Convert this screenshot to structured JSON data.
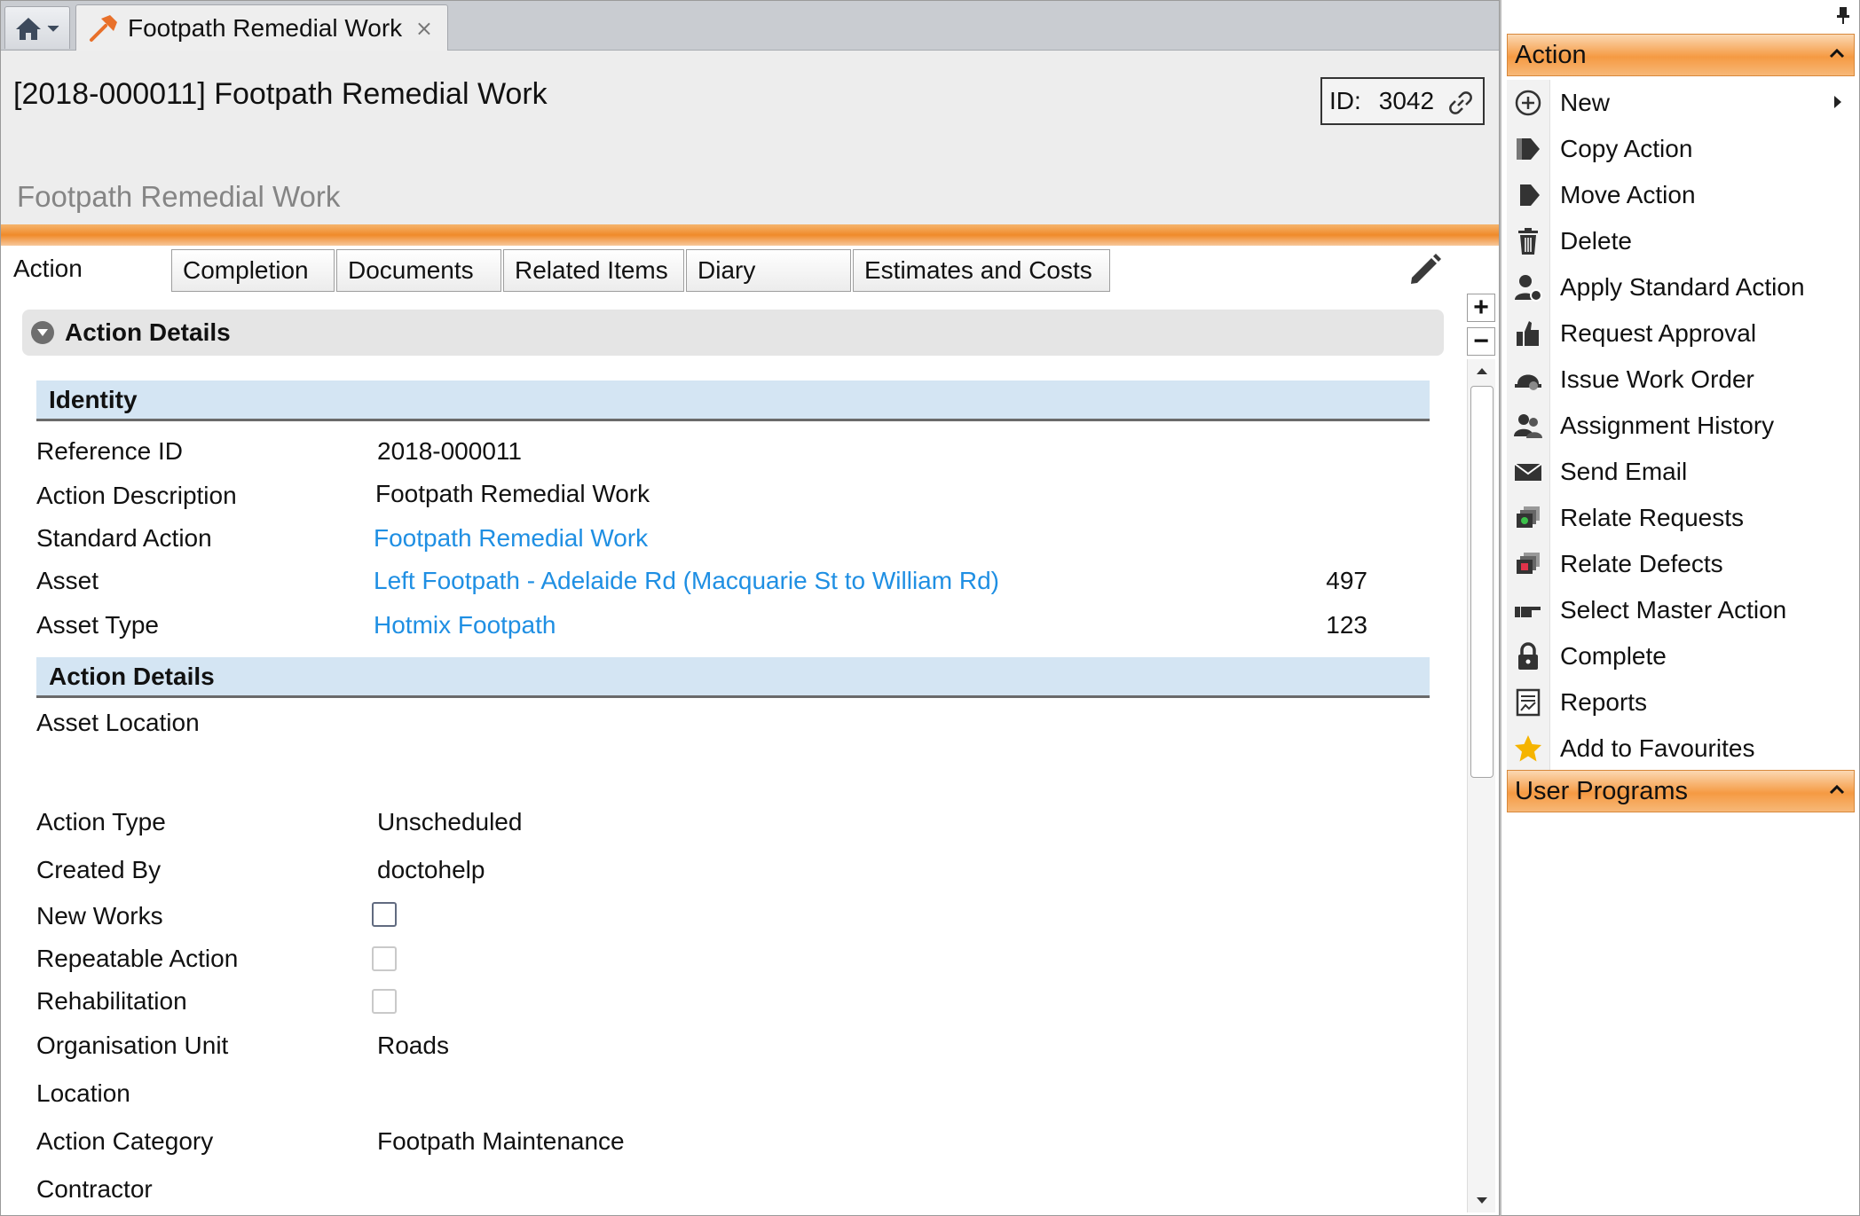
{
  "tabstrip": {
    "doc_tab_title": "Footpath Remedial Work",
    "close_symbol": "×"
  },
  "header": {
    "title": "[2018-000011] Footpath Remedial Work",
    "id_label": "ID:",
    "id_value": "3042",
    "subtitle": "Footpath Remedial Work"
  },
  "form_tabs": [
    "Action",
    "Completion",
    "Documents",
    "Related Items",
    "Diary",
    "Estimates and Costs"
  ],
  "section": {
    "title": "Action Details"
  },
  "identity": {
    "heading": "Identity",
    "reference_id_label": "Reference ID",
    "reference_id_value": "2018-000011",
    "action_description_label": "Action Description",
    "action_description_value": "Footpath Remedial Work",
    "standard_action_label": "Standard Action",
    "standard_action_value": "Footpath Remedial Work",
    "asset_label": "Asset",
    "asset_value": "Left Footpath - Adelaide Rd (Macquarie St to William Rd)",
    "asset_number": "497",
    "asset_type_label": "Asset Type",
    "asset_type_value": "Hotmix Footpath",
    "asset_type_number": "123"
  },
  "action_details": {
    "heading": "Action Details",
    "asset_location_label": "Asset Location",
    "action_type_label": "Action Type",
    "action_type_value": "Unscheduled",
    "created_by_label": "Created By",
    "created_by_value": "doctohelp",
    "new_works_label": "New Works",
    "new_works_checked": false,
    "repeatable_action_label": "Repeatable Action",
    "repeatable_action_checked": false,
    "rehabilitation_label": "Rehabilitation",
    "rehabilitation_checked": false,
    "organisation_unit_label": "Organisation Unit",
    "organisation_unit_value": "Roads",
    "location_label": "Location",
    "action_category_label": "Action Category",
    "action_category_value": "Footpath Maintenance",
    "contractor_label": "Contractor"
  },
  "scroll": {
    "plus_symbol": "+",
    "minus_symbol": "−"
  },
  "side_panel": {
    "action_heading": "Action",
    "user_programs_heading": "User Programs",
    "menu": [
      {
        "label": "New",
        "icon": "plus-circle-icon"
      },
      {
        "label": "Copy Action",
        "icon": "copy-action-icon"
      },
      {
        "label": "Move Action",
        "icon": "move-action-icon"
      },
      {
        "label": "Delete",
        "icon": "trash-icon"
      },
      {
        "label": "Apply Standard Action",
        "icon": "user-gear-icon"
      },
      {
        "label": "Request Approval",
        "icon": "thumbs-up-icon"
      },
      {
        "label": "Issue Work Order",
        "icon": "hard-hat-icon"
      },
      {
        "label": "Assignment History",
        "icon": "users-icon"
      },
      {
        "label": "Send Email",
        "icon": "envelope-icon"
      },
      {
        "label": "Relate Requests",
        "icon": "stack-green-icon"
      },
      {
        "label": "Relate Defects",
        "icon": "stack-red-icon"
      },
      {
        "label": "Select Master Action",
        "icon": "pointing-hand-icon"
      },
      {
        "label": "Complete",
        "icon": "lock-icon"
      },
      {
        "label": "Reports",
        "icon": "report-icon"
      },
      {
        "label": "Add to Favourites",
        "icon": "star-icon"
      }
    ]
  },
  "colors": {
    "accent_orange": "#f59a43",
    "link_blue": "#1f8fe3",
    "group_header_blue": "#d4e5f3",
    "star_gold": "#f5b400"
  }
}
